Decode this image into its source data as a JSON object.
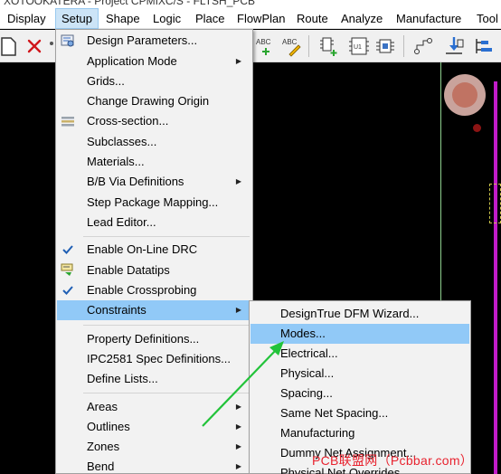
{
  "title": "XOTOOKATERA - Project CPMIXC/S - FLTSH_PCB",
  "menubar": [
    {
      "label": "Display",
      "active": false
    },
    {
      "label": "Setup",
      "active": true
    },
    {
      "label": "Shape",
      "active": false
    },
    {
      "label": "Logic",
      "active": false
    },
    {
      "label": "Place",
      "active": false
    },
    {
      "label": "FlowPlan",
      "active": false
    },
    {
      "label": "Route",
      "active": false
    },
    {
      "label": "Analyze",
      "active": false
    },
    {
      "label": "Manufacture",
      "active": false
    },
    {
      "label": "Tool",
      "active": false
    }
  ],
  "toolbar": {
    "abc1": "ABC",
    "abc2": "ABC",
    "u1": "U1"
  },
  "setup_menu": {
    "items": [
      {
        "label": "Design Parameters...",
        "submenu": false
      },
      {
        "label": "Application Mode",
        "submenu": true
      },
      {
        "label": "Grids...",
        "submenu": false
      },
      {
        "label": "Change Drawing Origin",
        "submenu": false
      },
      {
        "label": "Cross-section...",
        "submenu": false
      },
      {
        "label": "Subclasses...",
        "submenu": false
      },
      {
        "label": "Materials...",
        "submenu": false
      },
      {
        "label": "B/B Via Definitions",
        "submenu": true
      },
      {
        "label": "Step Package Mapping...",
        "submenu": false
      },
      {
        "label": "Lead Editor...",
        "submenu": false
      },
      {
        "label": "Enable On-Line DRC",
        "submenu": false,
        "checked": true
      },
      {
        "label": "Enable Datatips",
        "submenu": false
      },
      {
        "label": "Enable Crossprobing",
        "submenu": false,
        "checked": true
      },
      {
        "label": "Constraints",
        "submenu": true,
        "highlighted": true
      },
      {
        "label": "Property Definitions...",
        "submenu": false
      },
      {
        "label": "IPC2581 Spec Definitions...",
        "submenu": false
      },
      {
        "label": "Define Lists...",
        "submenu": false
      },
      {
        "label": "Areas",
        "submenu": true
      },
      {
        "label": "Outlines",
        "submenu": true
      },
      {
        "label": "Zones",
        "submenu": true
      },
      {
        "label": "Bend",
        "submenu": true
      }
    ]
  },
  "constraints_submenu": {
    "items": [
      {
        "label": "DesignTrue DFM Wizard..."
      },
      {
        "label": "Modes...",
        "highlighted": true
      },
      {
        "label": "Electrical..."
      },
      {
        "label": "Physical..."
      },
      {
        "label": "Spacing..."
      },
      {
        "label": "Same Net Spacing..."
      },
      {
        "label": "Manufacturing"
      },
      {
        "label": "Dummy Net Assignment..."
      },
      {
        "label": "Physical Net Overrides"
      }
    ]
  },
  "watermark": "PCB联盟网（Pcbbar.com）",
  "colors": {
    "menu_highlight": "#91c9f7",
    "annotation_arrow": "#22c33a",
    "canvas": "#000000",
    "pink_trace": "#c21cc9"
  }
}
